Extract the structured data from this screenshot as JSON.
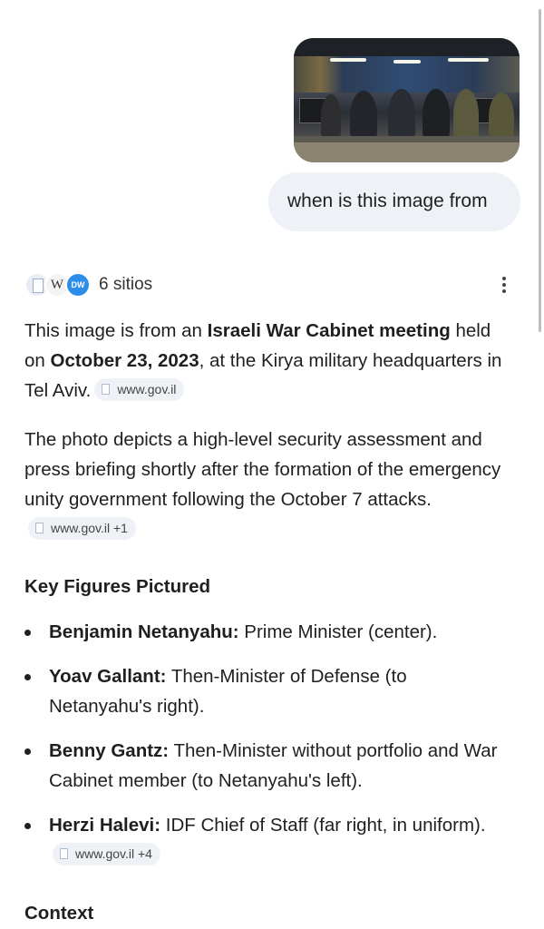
{
  "user_query": "when is this image from",
  "sources": {
    "label": "6 sitios",
    "icons": [
      "document-icon",
      "wikipedia-icon",
      "dw-icon"
    ],
    "icon_letters": {
      "wikipedia": "W",
      "dw": "DW"
    }
  },
  "answer": {
    "intro_a": "This image is from an ",
    "intro_b": "Israeli War Cabinet meeting",
    "intro_c": " held on ",
    "intro_d": "October 23, 2023",
    "intro_e": ", at the Kirya military headquarters in Tel Aviv.",
    "chip1": "www.gov.il",
    "para2": "The photo depicts a high-level security assessment and press briefing shortly after the formation of the emergency unity government following the October 7 attacks.",
    "chip2": "www.gov.il +1",
    "key_figures_heading": "Key Figures Pictured",
    "figures": [
      {
        "name": "Benjamin Netanyahu:",
        "desc": " Prime Minister (center)."
      },
      {
        "name": "Yoav Gallant:",
        "desc": " Then-Minister of Defense (to Netanyahu's right)."
      },
      {
        "name": "Benny Gantz:",
        "desc": " Then-Minister without portfolio and War Cabinet member (to Netanyahu's left)."
      },
      {
        "name": "Herzi Halevi:",
        "desc": " IDF Chief of Staff (far right, in uniform)."
      }
    ],
    "chip3": "www.gov.il +4",
    "context_heading": "Context"
  }
}
